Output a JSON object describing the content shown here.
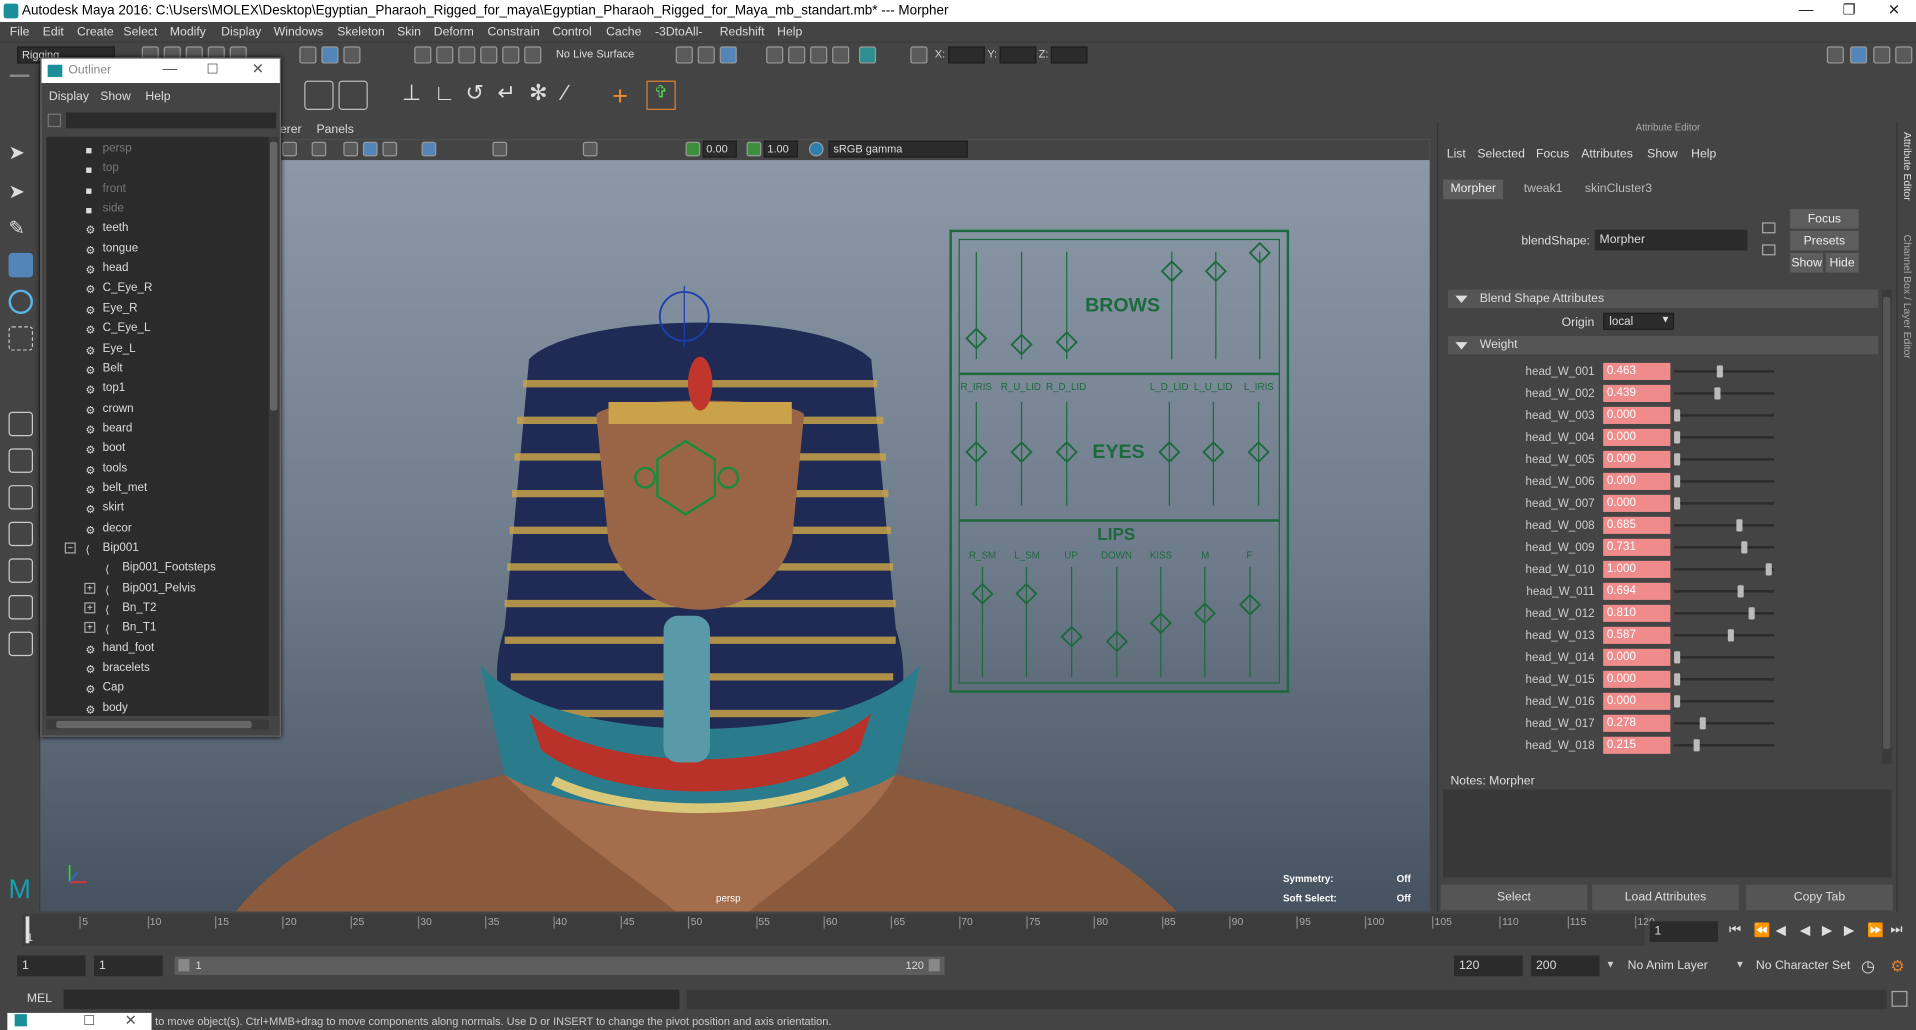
{
  "window_title": "Autodesk Maya 2016: C:\\Users\\MOLEX\\Desktop\\Egyptian_Pharaoh_Rigged_for_maya\\Egyptian_Pharaoh_Rigged_for_Maya_mb_standart.mb*   ---   Morpher",
  "menu": [
    "File",
    "Edit",
    "Create",
    "Select",
    "Modify",
    "Display",
    "Windows",
    "Skeleton",
    "Skin",
    "Deform",
    "Constrain",
    "Control",
    "Cache",
    "-3DtoAll-",
    "Redshift",
    "Help"
  ],
  "shelf": {
    "mode": "Rigging",
    "live_surface": "No Live Surface",
    "x_label": "X:",
    "y_label": "Y:",
    "z_label": "Z:"
  },
  "outliner": {
    "title": "Outliner",
    "menu": [
      "Display",
      "Show",
      "Help"
    ],
    "items": [
      {
        "label": "persp",
        "dim": true
      },
      {
        "label": "top",
        "dim": true
      },
      {
        "label": "front",
        "dim": true
      },
      {
        "label": "side",
        "dim": true
      },
      {
        "label": "teeth"
      },
      {
        "label": "tongue"
      },
      {
        "label": "head"
      },
      {
        "label": "C_Eye_R"
      },
      {
        "label": "Eye_R"
      },
      {
        "label": "C_Eye_L"
      },
      {
        "label": "Eye_L"
      },
      {
        "label": "Belt"
      },
      {
        "label": "top1"
      },
      {
        "label": "crown"
      },
      {
        "label": "beard"
      },
      {
        "label": "boot"
      },
      {
        "label": "tools"
      },
      {
        "label": "belt_met"
      },
      {
        "label": "skirt"
      },
      {
        "label": "decor"
      },
      {
        "label": "Bip001"
      },
      {
        "label": "Bip001_Footsteps"
      },
      {
        "label": "Bip001_Pelvis"
      },
      {
        "label": "Bn_T2"
      },
      {
        "label": "Bn_T1"
      },
      {
        "label": "hand_foot"
      },
      {
        "label": "bracelets"
      },
      {
        "label": "Cap"
      },
      {
        "label": "body"
      }
    ]
  },
  "viewport": {
    "menu": [
      "erer",
      "Panels"
    ],
    "field1": "0.00",
    "field2": "1.00",
    "color_space": "sRGB gamma",
    "camera": "persp",
    "symmetry_label": "Symmetry:",
    "symmetry_val": "Off",
    "soft_label": "Soft Select:",
    "soft_val": "Off",
    "panel": {
      "brows": "BROWS",
      "eyes": "EYES",
      "lips": "LIPS",
      "eye_labels": [
        "R_IRIS",
        "R_U_LID",
        "R_D_LID",
        "L_D_LID",
        "L_U_LID",
        "L_IRIS"
      ],
      "lip_labels": [
        "R_SM",
        "L_SM",
        "UP",
        "DOWN",
        "KISS",
        "M",
        "F"
      ]
    }
  },
  "attr": {
    "title": "Attribute Editor",
    "menu": [
      "List",
      "Selected",
      "Focus",
      "Attributes",
      "Show",
      "Help"
    ],
    "tabs": [
      "Morpher",
      "tweak1",
      "skinCluster3"
    ],
    "blendshape_label": "blendShape:",
    "blendshape_value": "Morpher",
    "focus": "Focus",
    "presets": "Presets",
    "show": "Show",
    "hide": "Hide",
    "section1": "Blend Shape Attributes",
    "origin_label": "Origin",
    "origin_value": "local",
    "section2": "Weight",
    "weights": [
      {
        "name": "head_W_001",
        "value": 0.463
      },
      {
        "name": "head_W_002",
        "value": 0.439
      },
      {
        "name": "head_W_003",
        "value": 0.0
      },
      {
        "name": "head_W_004",
        "value": 0.0
      },
      {
        "name": "head_W_005",
        "value": 0.0
      },
      {
        "name": "head_W_006",
        "value": 0.0
      },
      {
        "name": "head_W_007",
        "value": 0.0
      },
      {
        "name": "head_W_008",
        "value": 0.685
      },
      {
        "name": "head_W_009",
        "value": 0.731
      },
      {
        "name": "head_W_010",
        "value": 1.0
      },
      {
        "name": "head_W_011",
        "value": 0.694
      },
      {
        "name": "head_W_012",
        "value": 0.81
      },
      {
        "name": "head_W_013",
        "value": 0.587
      },
      {
        "name": "head_W_014",
        "value": 0.0
      },
      {
        "name": "head_W_015",
        "value": 0.0
      },
      {
        "name": "head_W_016",
        "value": 0.0
      },
      {
        "name": "head_W_017",
        "value": 0.278
      },
      {
        "name": "head_W_018",
        "value": 0.215
      }
    ],
    "notes": "Notes:  Morpher",
    "buttons": [
      "Select",
      "Load Attributes",
      "Copy Tab"
    ]
  },
  "right_tabs": [
    "Attribute Editor",
    "Channel Box / Layer Editor"
  ],
  "timeline": {
    "ticks": [
      "5",
      "10",
      "15",
      "20",
      "25",
      "30",
      "35",
      "40",
      "45",
      "50",
      "55",
      "60",
      "65",
      "70",
      "75",
      "80",
      "85",
      "90",
      "95",
      "100",
      "105",
      "110",
      "115",
      "120"
    ],
    "start_label": "1",
    "current": "1"
  },
  "range": {
    "start": "1",
    "start2": "1",
    "slider_start": "1",
    "slider_end": "120",
    "end": "120",
    "end2": "200",
    "anim_layer": "No Anim Layer",
    "char_set": "No Character Set"
  },
  "mel": "MEL",
  "help_text": "to move object(s). Ctrl+MMB+drag to move components along normals. Use D or INSERT to change the pivot position and axis orientation."
}
